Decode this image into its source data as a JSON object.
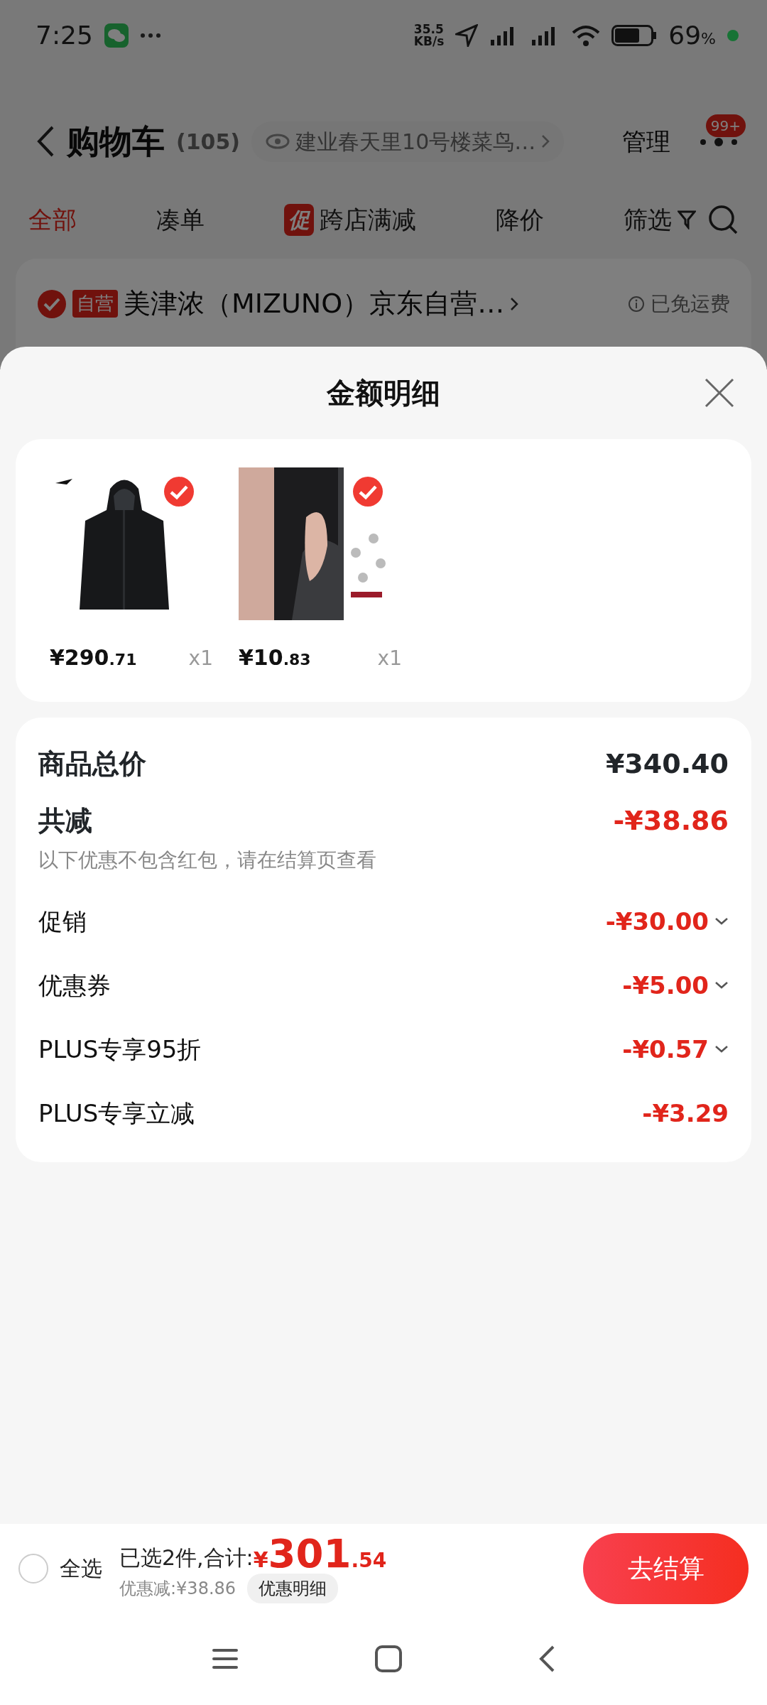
{
  "status_bar": {
    "time": "7:25",
    "speed_value": "35.5",
    "speed_unit": "KB/s",
    "battery": "69",
    "battery_unit": "%"
  },
  "header": {
    "title": "购物车",
    "count": "(105)",
    "address": "建业春天里10号楼菜鸟…",
    "manage": "管理",
    "badge": "99+"
  },
  "tabs": [
    {
      "label": "全部",
      "selected": true
    },
    {
      "label": "凑单",
      "selected": false
    },
    {
      "label": "跨店满减",
      "selected": false,
      "tag": "促"
    },
    {
      "label": "降价",
      "selected": false
    },
    {
      "label": "筛选",
      "selected": false
    }
  ],
  "store": {
    "checked": true,
    "tag": "自营",
    "name": "美津浓（MIZUNO）京东自营…",
    "shipping": "已免运费"
  },
  "sheet": {
    "title": "金额明细",
    "products": [
      {
        "kind": "picture",
        "checked": true,
        "price_main": "¥290",
        "price_decimal": ".71",
        "quantity": "x1"
      },
      {
        "kind": "picture",
        "checked": true,
        "price_main": "¥10",
        "price_decimal": ".83",
        "quantity": "x1"
      }
    ],
    "total": {
      "label": "商品总价",
      "value": "¥340.40"
    },
    "reduction": {
      "label": "共减",
      "value": "-¥38.86",
      "note": "以下优惠不包含红包，请在结算页查看"
    },
    "items": [
      {
        "label": "促销",
        "value": "-¥30.00",
        "expandable": true
      },
      {
        "label": "优惠券",
        "value": "-¥5.00",
        "expandable": true
      },
      {
        "label": "PLUS专享95折",
        "value": "-¥0.57",
        "expandable": true
      },
      {
        "label": "PLUS专享立减",
        "value": "-¥3.29",
        "expandable": false
      }
    ]
  },
  "footer": {
    "select_all": {
      "label": "全选",
      "checked": false
    },
    "summary": "已选2件,合计:",
    "currency": "¥",
    "amount_main": "301",
    "amount_decimal": ".54",
    "discount": "优惠减:¥38.86",
    "detail_button": "优惠明细",
    "checkout": "去结算"
  }
}
